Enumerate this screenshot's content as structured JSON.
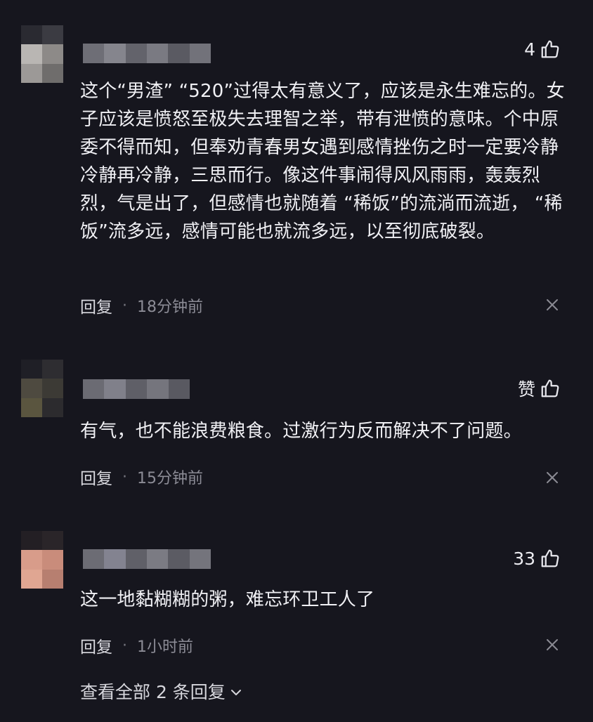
{
  "comments": [
    {
      "like_count": "4",
      "text": "这个“男渣” “520”过得太有意义了，应该是永生难忘的。女子应该是愤怒至极失去理智之举，带有泄愤的意味。个中原委不得而知，但奉劝青春男女遇到感情挫伤之时一定要冷静冷静再冷静，三思而行。像这件事闹得风风雨雨，轰轰烈烈，气是出了，但感情也就随着 “稀饭”的流淌而流逝， “稀饭”流多远，感情可能也就流多远，以至彻底破裂。",
      "reply_label": "回复",
      "timestamp": "18分钟前"
    },
    {
      "like_count": "赞",
      "text": "有气，也不能浪费粮食。过激行为反而解决不了问题。",
      "reply_label": "回复",
      "timestamp": "15分钟前"
    },
    {
      "like_count": "33",
      "text": "这一地黏糊糊的粥，难忘环卫工人了",
      "reply_label": "回复",
      "timestamp": "1小时前"
    }
  ],
  "view_all_replies": "查看全部 2 条回复",
  "meta_separator": "·",
  "icons": {
    "like": "thumb-up-icon",
    "close": "close-icon",
    "expand": "chevron-down-icon"
  },
  "colors": {
    "background": "#16161e",
    "text": "#f0f0f4",
    "muted": "#8c8c96"
  }
}
